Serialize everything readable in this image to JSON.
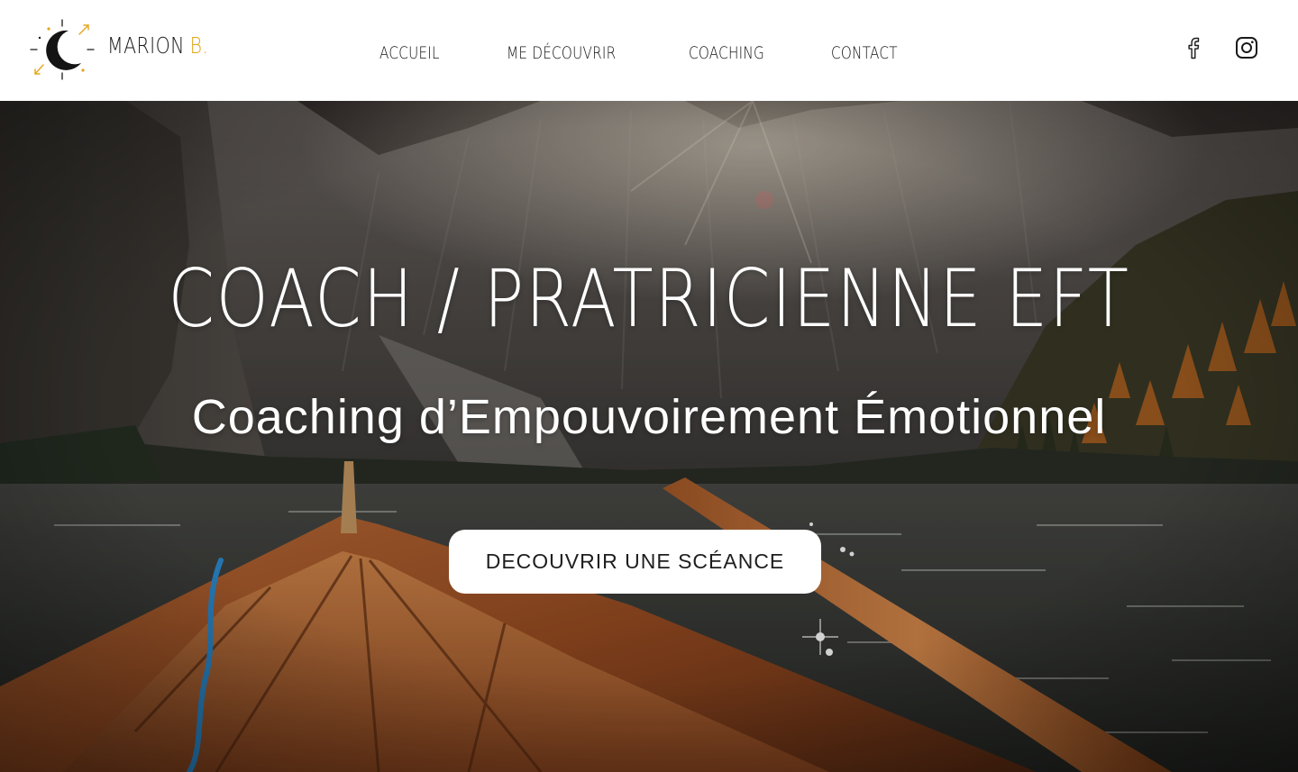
{
  "brand": {
    "first_name": "MARION",
    "last_initial": "B.",
    "accent_color": "#e3a51b",
    "logo_icon": "crescent-moon-compass-icon"
  },
  "nav": {
    "items": [
      {
        "label": "ACCUEIL"
      },
      {
        "label": "ME DÉCOUVRIR"
      },
      {
        "label": "COACHING"
      },
      {
        "label": "CONTACT"
      }
    ]
  },
  "social": {
    "facebook_icon": "facebook-icon",
    "instagram_icon": "instagram-icon"
  },
  "hero": {
    "title": "COACH / PRATRICIENNE EFT",
    "subtitle": "Coaching d’Empouvoirement Émotionnel",
    "cta_label": "DECOUVRIR UNE SCÉANCE",
    "background": "mountain lake with wooden rowing boat"
  }
}
